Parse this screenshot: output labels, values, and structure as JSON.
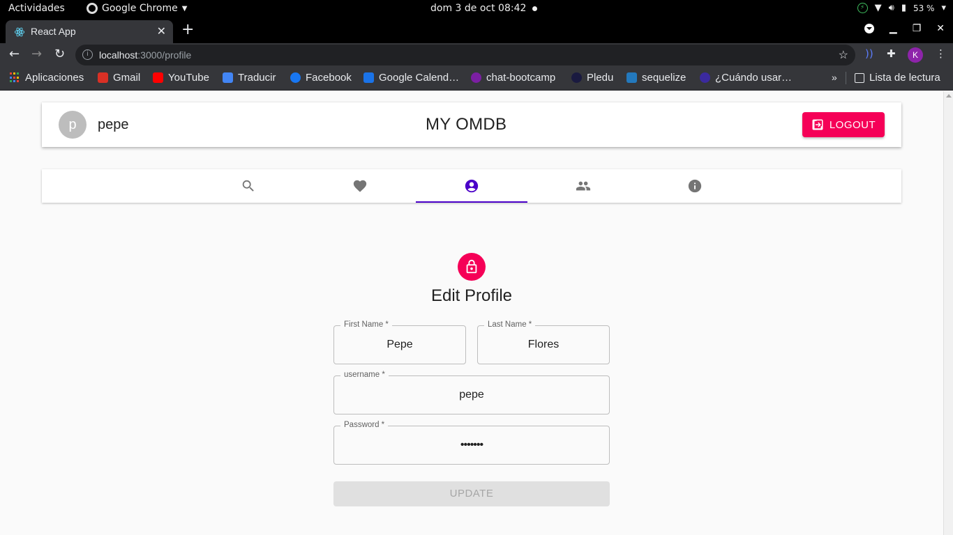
{
  "system_bar": {
    "activities": "Actividades",
    "app_name": "Google Chrome",
    "datetime": "dom  3 de oct  08:42",
    "battery": "53 %"
  },
  "browser": {
    "tab_title": "React App",
    "url_host": "localhost",
    "url_path": ":3000/profile",
    "profile_initial": "K",
    "bookmarks": [
      {
        "label": "Aplicaciones",
        "color": "#e53935"
      },
      {
        "label": "Gmail",
        "color": "#d93025"
      },
      {
        "label": "YouTube",
        "color": "#ff0000"
      },
      {
        "label": "Traducir",
        "color": "#4285f4"
      },
      {
        "label": "Facebook",
        "color": "#1877f2"
      },
      {
        "label": "Google Calend…",
        "color": "#1a73e8"
      },
      {
        "label": "chat-bootcamp",
        "color": "#7b1fa2"
      },
      {
        "label": "Pledu",
        "color": "#1a1a40"
      },
      {
        "label": "sequelize",
        "color": "#2379bd"
      },
      {
        "label": "¿Cuándo usar…",
        "color": "#3b2a9e"
      }
    ],
    "reading_list": "Lista de lectura"
  },
  "app": {
    "user_initial": "p",
    "username": "pepe",
    "brand": "MY OMDB",
    "logout_label": "LOGOUT",
    "accent_color": "#f50057",
    "tabs": [
      {
        "icon": "search-icon",
        "active": false
      },
      {
        "icon": "heart-icon",
        "active": false
      },
      {
        "icon": "account-circle-icon",
        "active": true
      },
      {
        "icon": "people-icon",
        "active": false
      },
      {
        "icon": "info-icon",
        "active": false
      }
    ]
  },
  "form": {
    "title": "Edit Profile",
    "first_name_label": "First Name *",
    "first_name_value": "Pepe",
    "last_name_label": "Last Name *",
    "last_name_value": "Flores",
    "username_label": "username *",
    "username_value": "pepe",
    "password_label": "Password *",
    "password_value": "•••••••",
    "submit_label": "UPDATE"
  }
}
